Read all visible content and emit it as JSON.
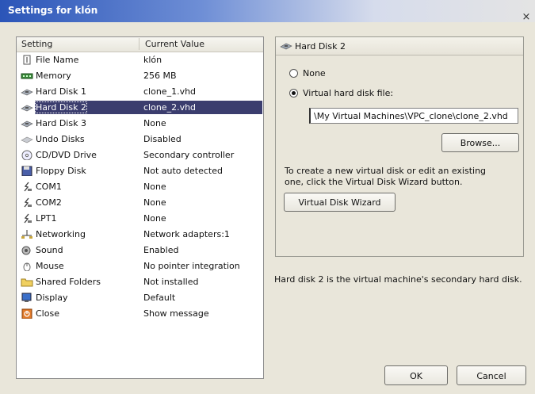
{
  "window": {
    "title": "Settings for klón",
    "close_label": "×"
  },
  "list": {
    "header": {
      "setting": "Setting",
      "value": "Current Value"
    },
    "items": [
      {
        "icon": "file-name-icon",
        "label": "File Name",
        "value": "klón"
      },
      {
        "icon": "memory-icon",
        "label": "Memory",
        "value": "256 MB"
      },
      {
        "icon": "hard-disk-icon",
        "label": "Hard Disk 1",
        "value": "clone_1.vhd"
      },
      {
        "icon": "hard-disk-icon",
        "label": "Hard Disk 2",
        "value": "clone_2.vhd",
        "selected": true
      },
      {
        "icon": "hard-disk-icon",
        "label": "Hard Disk 3",
        "value": "None"
      },
      {
        "icon": "undo-disks-icon",
        "label": "Undo Disks",
        "value": "Disabled"
      },
      {
        "icon": "cd-dvd-icon",
        "label": "CD/DVD Drive",
        "value": "Secondary controller"
      },
      {
        "icon": "floppy-icon",
        "label": "Floppy Disk",
        "value": "Not auto detected"
      },
      {
        "icon": "com-port-icon",
        "label": "COM1",
        "value": "None"
      },
      {
        "icon": "com-port-icon",
        "label": "COM2",
        "value": "None"
      },
      {
        "icon": "lpt-port-icon",
        "label": "LPT1",
        "value": "None"
      },
      {
        "icon": "network-icon",
        "label": "Networking",
        "value": "Network adapters:1"
      },
      {
        "icon": "sound-icon",
        "label": "Sound",
        "value": "Enabled"
      },
      {
        "icon": "mouse-icon",
        "label": "Mouse",
        "value": "No pointer integration"
      },
      {
        "icon": "shared-folders-icon",
        "label": "Shared Folders",
        "value": "Not installed"
      },
      {
        "icon": "display-icon",
        "label": "Display",
        "value": "Default"
      },
      {
        "icon": "close-setting-icon",
        "label": "Close",
        "value": "Show message"
      }
    ]
  },
  "detail": {
    "title": "Hard Disk 2",
    "option_none": "None",
    "option_file": "Virtual hard disk file:",
    "selected_option": "file",
    "path_value": "\\My Virtual Machines\\VPC_clone\\clone_2.vhd",
    "browse_label": "Browse...",
    "help_text_line1": "To create a new virtual disk or edit an existing",
    "help_text_line2": "one, click the Virtual Disk Wizard button.",
    "wizard_label": "Virtual Disk Wizard"
  },
  "status_text": "Hard disk 2 is the virtual machine's secondary hard disk.",
  "buttons": {
    "ok": "OK",
    "cancel": "Cancel"
  },
  "colors": {
    "selection": "#3b3d6e",
    "title_bar": "#2b55b8"
  }
}
